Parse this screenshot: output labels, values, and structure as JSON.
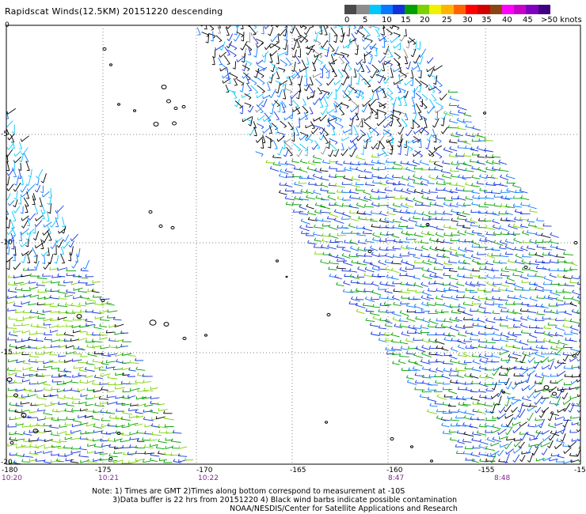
{
  "title": "Rapidscat Winds(12.5KM) 20151220 descending",
  "legend": {
    "colors": [
      "#4a4a4a",
      "#8c8c8c",
      "#00c8ff",
      "#0a78ff",
      "#1432dc",
      "#00a000",
      "#7ad200",
      "#f0f000",
      "#ffb400",
      "#ff6400",
      "#ff0000",
      "#d20000",
      "#8b4513",
      "#ff00ff",
      "#c800c8",
      "#8000c0",
      "#400080"
    ],
    "labels": [
      "0",
      "5",
      "10",
      "15",
      "20",
      "25",
      "30",
      "35",
      "40",
      "45",
      ">50 knots"
    ]
  },
  "map": {
    "lat_labels": [
      "0",
      "-5",
      "-10",
      "-15",
      "-20"
    ],
    "lon_labels": [
      "-180",
      "-175",
      "-170",
      "-165",
      "-160",
      "-155",
      "-15"
    ],
    "time_labels": [
      "10:20",
      "10:21",
      "10:22",
      "8:47",
      "8:48"
    ],
    "colors": {
      "contamination": "#000000",
      "gridline": "#808080",
      "time_label": "#7a2a8a",
      "land": "#000000"
    }
  },
  "notes": {
    "line1": "Note: 1) Times are GMT 2)Times along bottom correspond to measurement at -10S",
    "line2": "3)Data buffer is 22 hrs from 20151220 4) Black wind barbs indicate possible contamination",
    "line3": "NOAA/NESDIS/Center for Satellite Applications and Research"
  }
}
